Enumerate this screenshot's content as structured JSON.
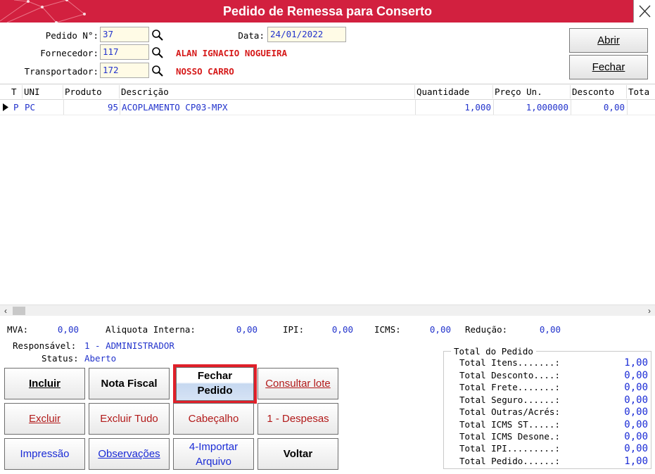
{
  "window": {
    "title": "Pedido de Remessa para Conserto"
  },
  "header": {
    "pedido_label": "Pedido N°:",
    "pedido_value": "37",
    "data_label": "Data:",
    "data_value": "24/01/2022",
    "fornecedor_label": "Fornecedor:",
    "fornecedor_code": "117",
    "fornecedor_name": "ALAN IGNACIO NOGUEIRA",
    "transportador_label": "Transportador:",
    "transportador_code": "172",
    "transportador_name": "NOSSO CARRO",
    "abrir_label": "Abrir",
    "fechar_label": "Fechar"
  },
  "grid": {
    "columns": [
      "T",
      "UNI",
      "Produto",
      "Descrição",
      "Quantidade",
      "Preço Un.",
      "Desconto",
      "Tota"
    ],
    "rows": [
      {
        "t": "P",
        "uni": "PC",
        "produto": "95",
        "descricao": "ACOPLAMENTO CP03-MPX",
        "quantidade": "1,000",
        "preco": "1,000000",
        "desconto": "0,00"
      }
    ]
  },
  "summary": {
    "mva_label": "MVA:",
    "mva_value": "0,00",
    "aliquota_label": "Aliquota Interna:",
    "aliquota_value": "0,00",
    "ipi_label": "IPI:",
    "ipi_value": "0,00",
    "icms_label": "ICMS:",
    "icms_value": "0,00",
    "reducao_label": "Redução:",
    "reducao_value": "0,00",
    "responsavel_label": "Responsável:",
    "responsavel_value": "1 - ADMINISTRADOR",
    "status_label": "Status:",
    "status_value": "Aberto"
  },
  "actions": {
    "incluir": "Incluir",
    "nota_fiscal": "Nota Fiscal",
    "fechar_pedido_1": "Fechar",
    "fechar_pedido_2": "Pedido",
    "consultar_lote": "Consultar lote",
    "excluir": "Excluir",
    "excluir_tudo": "Excluir Tudo",
    "cabecalho": "Cabeçalho",
    "despesas": "1 - Despesas",
    "impressao": "Impressão",
    "observacoes": "Observações",
    "importar_1": "4-Importar",
    "importar_2": "Arquivo",
    "voltar": "Voltar"
  },
  "totals": {
    "caption": "Total do Pedido",
    "rows": [
      {
        "label": "Total Itens.......:",
        "value": "1,00"
      },
      {
        "label": "Total Desconto....:",
        "value": "0,00"
      },
      {
        "label": "Total Frete.......:",
        "value": "0,00"
      },
      {
        "label": "Total Seguro......:",
        "value": "0,00"
      },
      {
        "label": "Total Outras/Acrés:",
        "value": "0,00"
      },
      {
        "label": "Total ICMS ST.....:",
        "value": "0,00"
      },
      {
        "label": "Total ICMS Desone.:",
        "value": "0,00"
      },
      {
        "label": "Total IPI.........:",
        "value": "0,00"
      },
      {
        "label": "Total Pedido......:",
        "value": "1,00"
      }
    ]
  },
  "colors": {
    "titlebar": "#d2203f",
    "highlight_border": "#e0202a",
    "value_blue": "#1a2bd6",
    "name_red": "#d61a1a"
  }
}
